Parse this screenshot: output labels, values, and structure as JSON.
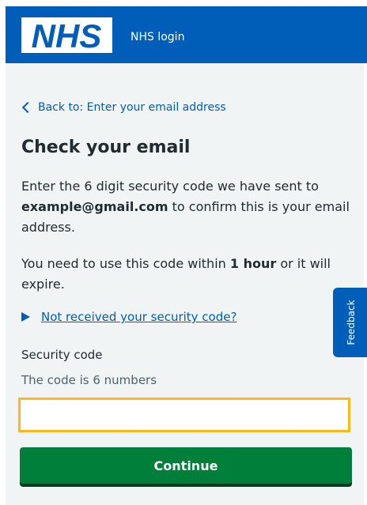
{
  "header": {
    "logo_text": "NHS",
    "service_name": "NHS login"
  },
  "nav": {
    "back_link": "Back to: Enter your email address"
  },
  "page": {
    "title": "Check your email",
    "intro": {
      "before": "Enter the 6 digit security code we have sent to ",
      "email": "example@gmail.com",
      "after": " to confirm this is your email address."
    },
    "expiry": {
      "before": "You need to use this code within ",
      "duration": "1 hour",
      "after": " or it will expire."
    },
    "details_summary": "Not received your security code?"
  },
  "form": {
    "label": "Security code",
    "hint": "The code is 6 numbers",
    "value": "",
    "button": "Continue"
  },
  "feedback": {
    "label": "Feedback"
  },
  "colors": {
    "nhs_blue": "#005eb8",
    "button_green": "#007f3b",
    "focus_yellow": "#ffb81c",
    "background": "#f0f4f5"
  }
}
